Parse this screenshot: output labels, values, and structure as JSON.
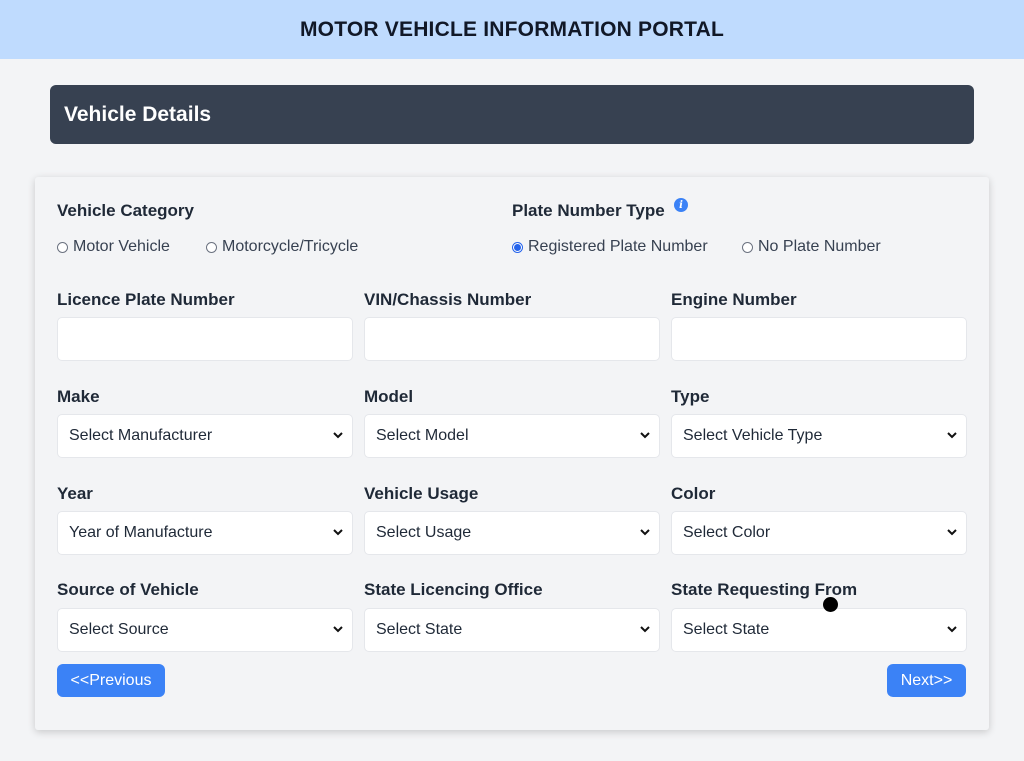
{
  "app": {
    "title": "MOTOR VEHICLE INFORMATION PORTAL"
  },
  "section": {
    "title": "Vehicle Details"
  },
  "vehicle_category": {
    "label": "Vehicle Category",
    "options": [
      "Motor Vehicle",
      "Motorcycle/Tricycle"
    ],
    "selected": null
  },
  "plate_number_type": {
    "label": "Plate Number Type",
    "info_icon": "info-icon",
    "options": [
      "Registered Plate Number",
      "No Plate Number"
    ],
    "selected": "Registered Plate Number"
  },
  "fields": {
    "licence_plate": {
      "label": "Licence Plate Number",
      "value": ""
    },
    "vin": {
      "label": "VIN/Chassis Number",
      "value": ""
    },
    "engine": {
      "label": "Engine Number",
      "value": ""
    },
    "make": {
      "label": "Make",
      "value": "Select Manufacturer"
    },
    "model": {
      "label": "Model",
      "value": "Select Model"
    },
    "type": {
      "label": "Type",
      "value": "Select Vehicle Type"
    },
    "year": {
      "label": "Year",
      "value": "Year of Manufacture"
    },
    "usage": {
      "label": "Vehicle Usage",
      "value": "Select Usage"
    },
    "color": {
      "label": "Color",
      "value": "Select Color"
    },
    "source": {
      "label": "Source of Vehicle",
      "value": "Select Source"
    },
    "state_office": {
      "label": "State Licencing Office",
      "value": "Select State"
    },
    "state_requesting": {
      "label": "State Requesting From",
      "value": "Select State"
    }
  },
  "buttons": {
    "previous": "<<Previous",
    "next": "Next>>"
  },
  "colors": {
    "topbar": "#bfdbfe",
    "header": "#374151",
    "accent": "#3b82f6"
  }
}
